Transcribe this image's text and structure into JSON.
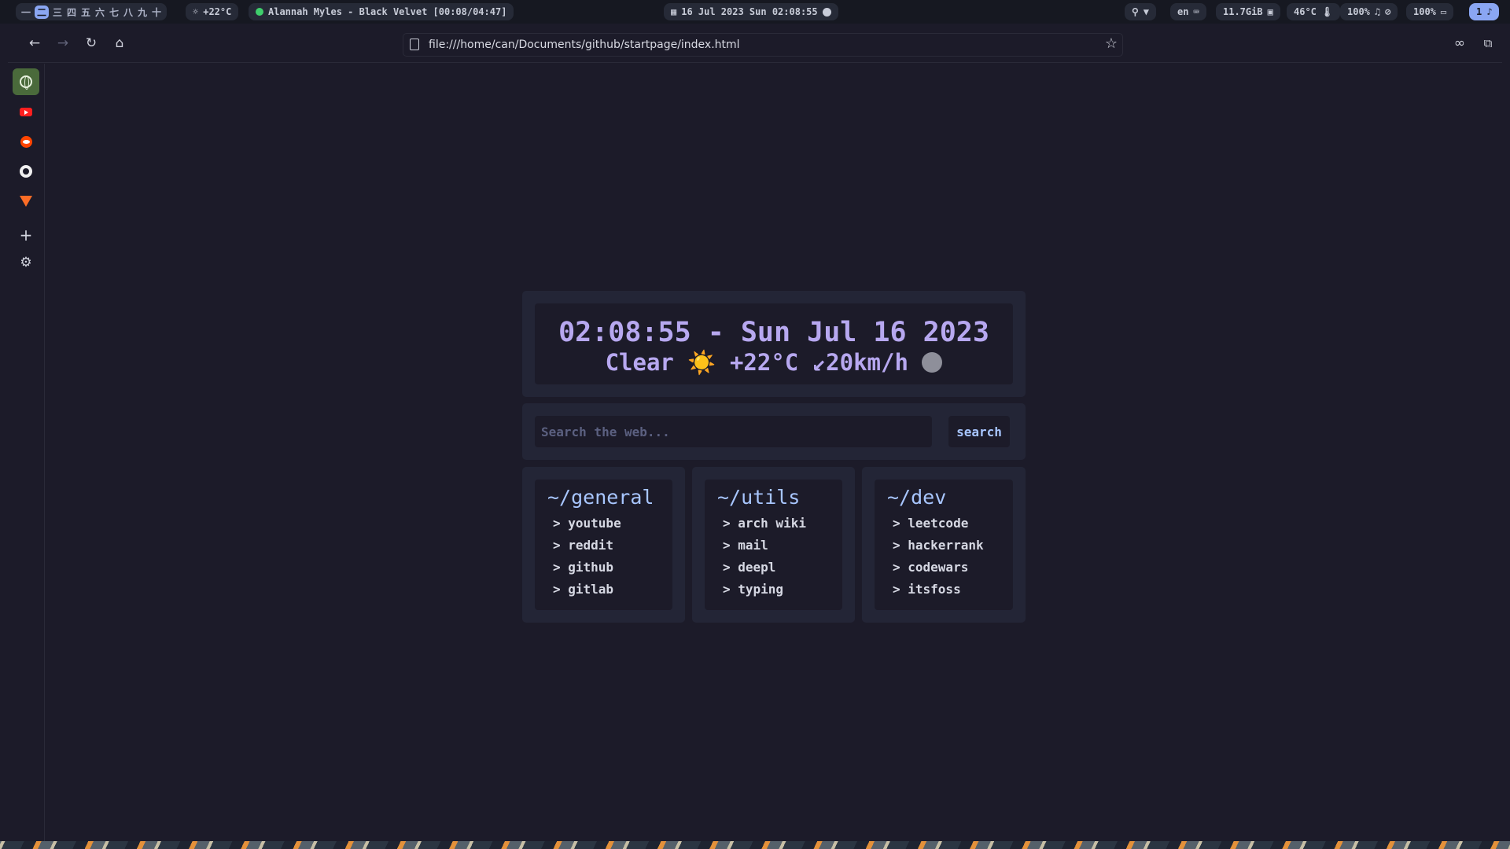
{
  "topbar": {
    "workspaces": [
      "一",
      "二",
      "三",
      "四",
      "五",
      "六",
      "七",
      "八",
      "九",
      "十"
    ],
    "active_workspace": "二",
    "weather": "+22°C",
    "media": "Alannah Myles - Black Velvet [00:08/04:47]",
    "datetime": "16 Jul 2023 Sun  02:08:55",
    "language": "en",
    "memory": "11.7GiB",
    "temperature": "46°C",
    "volume": "100%",
    "battery": "100%",
    "notifications": "1"
  },
  "browser": {
    "url": "file:///home/can/Documents/github/startpage/index.html"
  },
  "sidebar": {
    "items": [
      {
        "name": "web-panel",
        "icon": "globe-icon"
      },
      {
        "name": "youtube",
        "icon": "youtube-icon"
      },
      {
        "name": "reddit",
        "icon": "reddit-icon"
      },
      {
        "name": "github",
        "icon": "github-icon"
      },
      {
        "name": "gitlab",
        "icon": "gitlab-icon"
      }
    ],
    "add_symbol": "+",
    "settings_symbol": "⚙"
  },
  "startpage": {
    "clock": "02:08:55 - Sun Jul 16 2023",
    "weather_cond": "Clear",
    "weather_icon": "☀️",
    "weather_temp": "+22°C",
    "weather_wind": "↙20km/h",
    "search": {
      "placeholder": "Search the web...",
      "button": "search"
    },
    "columns": [
      {
        "title": "~/general",
        "links": [
          "> youtube",
          "> reddit",
          "> github",
          "> gitlab"
        ]
      },
      {
        "title": "~/utils",
        "links": [
          "> arch wiki",
          "> mail",
          "> deepl",
          "> typing"
        ]
      },
      {
        "title": "~/dev",
        "links": [
          "> leetcode",
          "> hackerrank",
          "> codewars",
          "> itsfoss"
        ]
      }
    ]
  },
  "colors": {
    "background": "#1c1b29",
    "card": "#232536",
    "accent_purple": "#b7a8f0",
    "accent_blue": "#a8c6ff"
  }
}
